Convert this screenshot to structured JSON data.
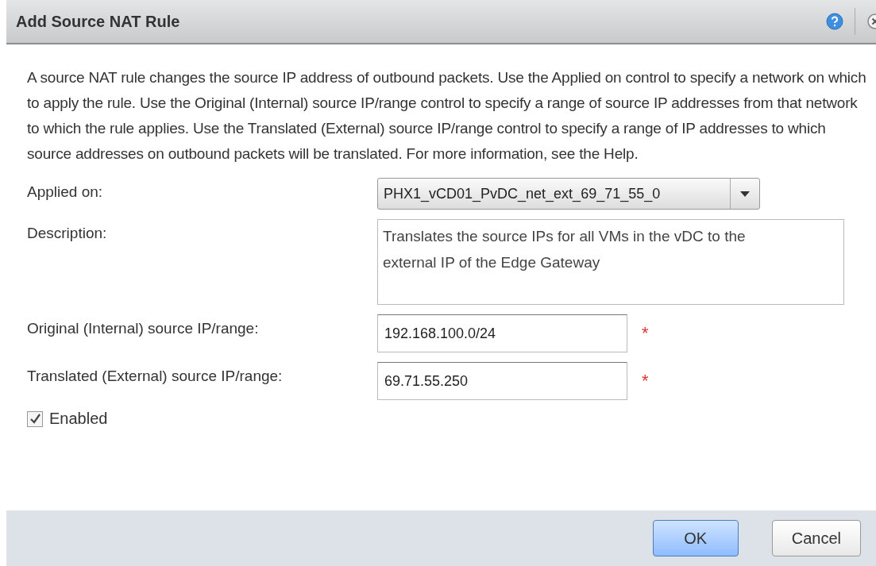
{
  "window": {
    "title": "Add Source NAT Rule"
  },
  "intro": "A source NAT rule changes the source IP address of outbound packets. Use the Applied on control to specify a network on which to apply the rule. Use the Original (Internal) source IP/range control to specify a range of source IP addresses from that network to which the rule applies. Use the Translated (External) source IP/range control to specify a range of IP addresses to which source addresses on outbound packets will be translated. For more information, see the Help.",
  "fields": [
    {
      "kind": "dropdown",
      "label": "Applied on:",
      "value": "PHX1_vCD01_PvDC_net_ext_69_71_55_0"
    },
    {
      "kind": "textarea",
      "label": "Description:",
      "value": "Translates the source IPs for all VMs in the vDC to the external IP of the Edge Gateway"
    },
    {
      "kind": "text",
      "label": "Original (Internal) source IP/range:",
      "value": "192.168.100.0/24",
      "required_mark": "*"
    },
    {
      "kind": "text",
      "label": "Translated (External) source IP/range:",
      "value": "69.71.55.250",
      "required_mark": "*"
    }
  ],
  "enabled": {
    "label": "Enabled",
    "checked": true
  },
  "buttons": [
    {
      "label": "OK",
      "primary": true
    },
    {
      "label": "Cancel",
      "primary": false
    }
  ]
}
